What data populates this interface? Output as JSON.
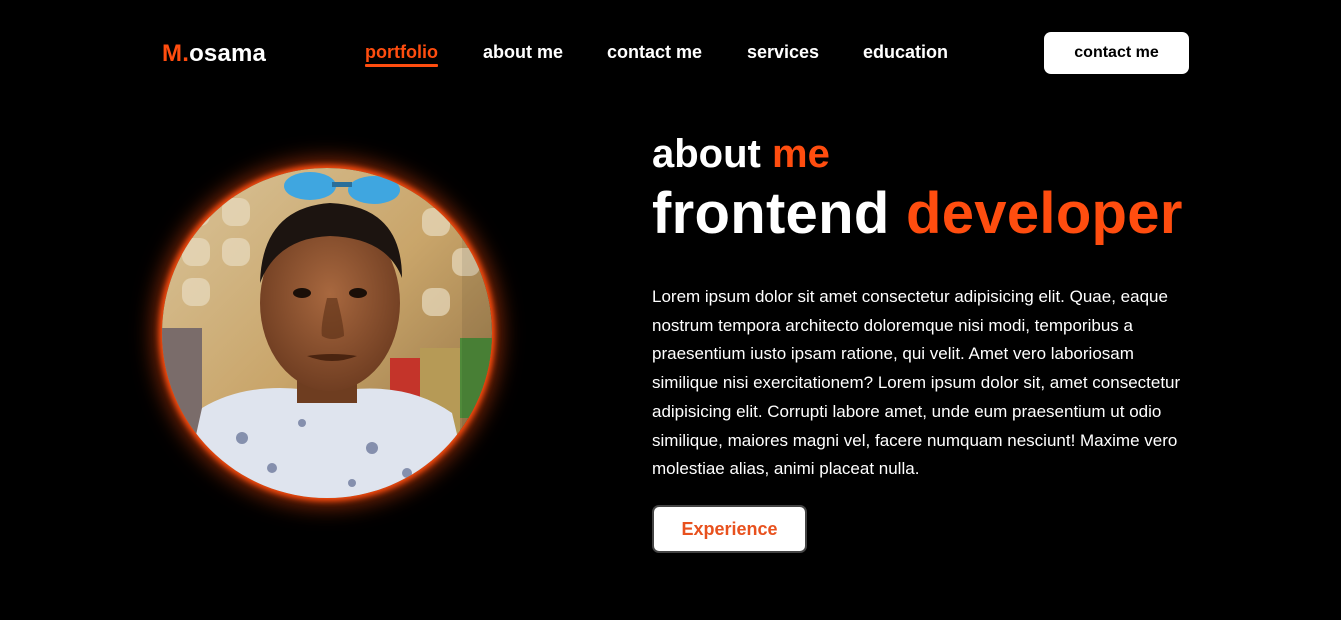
{
  "header": {
    "logo_prefix": "M.",
    "logo_name": "osama",
    "nav": [
      {
        "label": "portfolio",
        "active": true
      },
      {
        "label": "about me"
      },
      {
        "label": "contact me"
      },
      {
        "label": "services"
      },
      {
        "label": "education"
      }
    ],
    "cta_label": "contact me"
  },
  "about": {
    "subtitle_plain": "about",
    "subtitle_accent": "me",
    "title_plain": "frontend",
    "title_accent": "developer",
    "paragraph": "Lorem ipsum dolor sit amet consectetur adipisicing elit. Quae, eaque nostrum tempora architecto doloremque nisi modi, temporibus a praesentium iusto ipsam ratione, qui velit. Amet vero laboriosam similique nisi exercitationem? Lorem ipsum dolor sit, amet consectetur adipisicing elit. Corrupti labore amet, unde eum praesentium ut odio similique, maiores magni vel, facere numquam nesciunt! Maxime vero molestiae alias, animi placeat nulla.",
    "button_label": "Experience"
  },
  "theme": {
    "accent": "#ff4d0f",
    "background": "#000000",
    "button_text": "#e8511e"
  }
}
